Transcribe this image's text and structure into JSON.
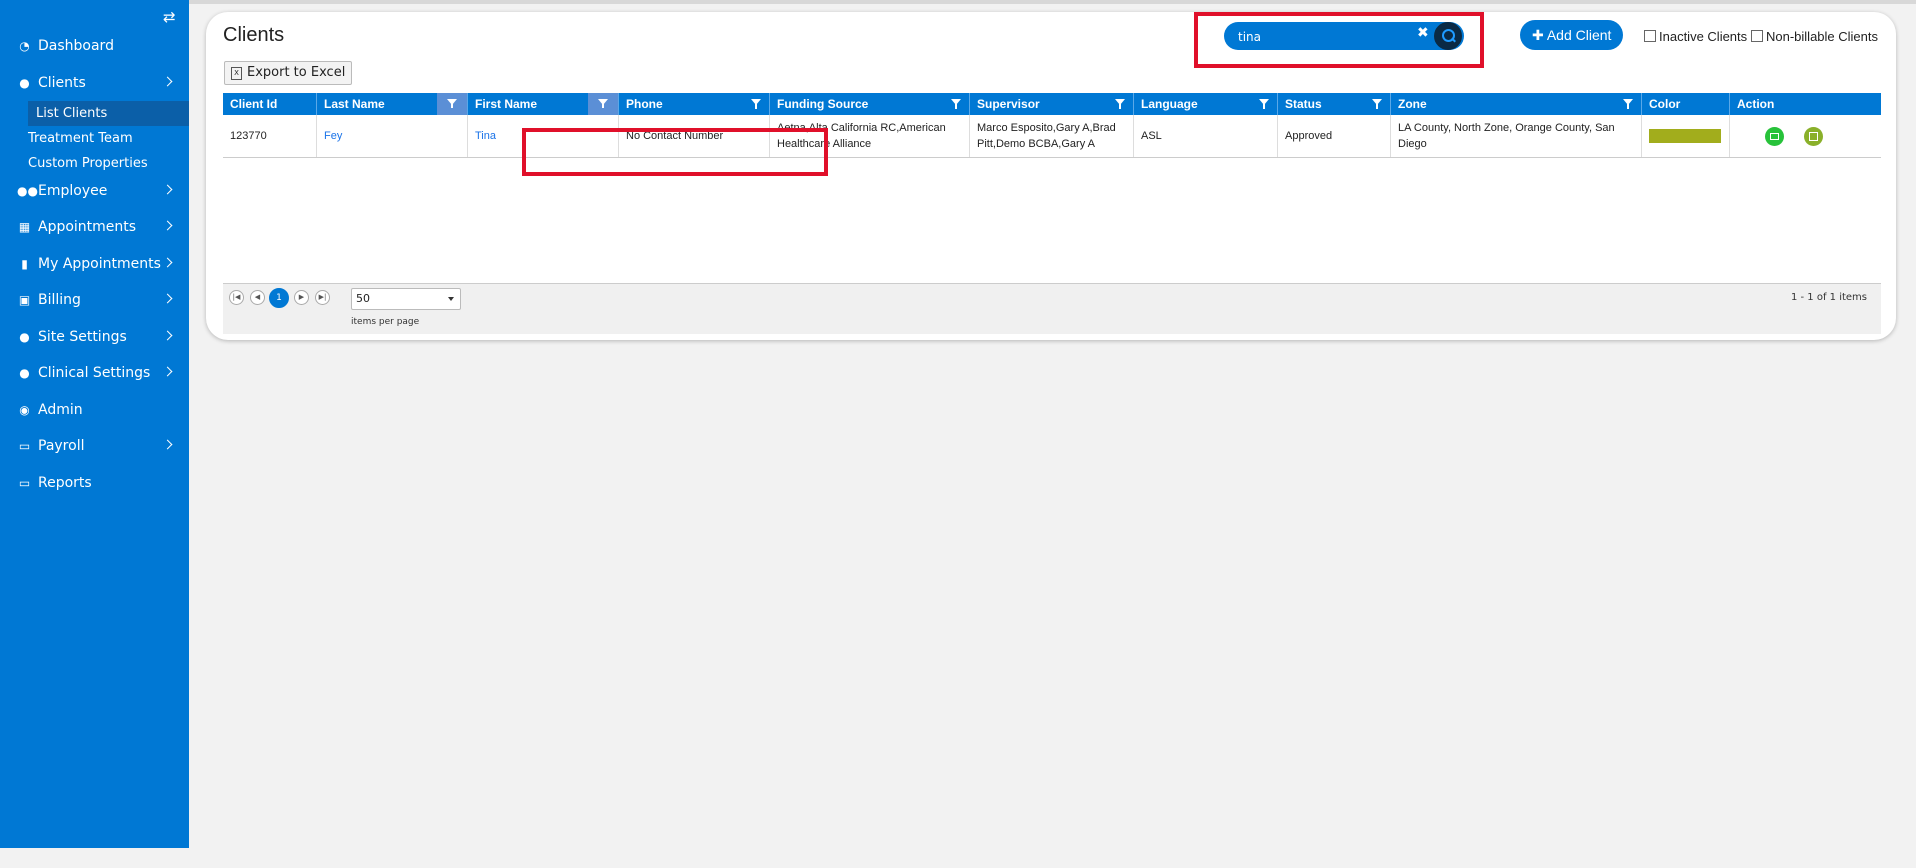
{
  "sidebar": {
    "toggle_icon": "swap-arrows-icon",
    "items": [
      {
        "label": "Dashboard",
        "icon": "dashboard-gauge-icon",
        "has_children": false
      },
      {
        "label": "Clients",
        "icon": "user-icon",
        "has_children": true
      },
      {
        "label": "Employee",
        "icon": "users-icon",
        "has_children": true
      },
      {
        "label": "Appointments",
        "icon": "calendar-icon",
        "has_children": true
      },
      {
        "label": "My Appointments",
        "icon": "bookmark-icon",
        "has_children": true
      },
      {
        "label": "Billing",
        "icon": "money-icon",
        "has_children": true
      },
      {
        "label": "Site Settings",
        "icon": "user-icon",
        "has_children": true
      },
      {
        "label": "Clinical Settings",
        "icon": "user-icon",
        "has_children": true
      },
      {
        "label": "Admin",
        "icon": "user-circle-icon",
        "has_children": false
      },
      {
        "label": "Payroll",
        "icon": "credit-card-icon",
        "has_children": true
      },
      {
        "label": "Reports",
        "icon": "credit-card-icon",
        "has_children": false
      }
    ],
    "clients_sub": [
      "List Clients",
      "Treatment Team",
      "Custom Properties"
    ]
  },
  "page": {
    "title": "Clients",
    "export_label": "Export to Excel",
    "search_value": "tina",
    "add_client_label": "✚ Add Client",
    "inactive_label": "Inactive Clients",
    "nonbillable_label": "Non-billable Clients"
  },
  "grid": {
    "columns": [
      "Client Id",
      "Last Name",
      "First Name",
      "Phone",
      "Funding Source",
      "Supervisor",
      "Language",
      "Status",
      "Zone",
      "Color",
      "Action"
    ],
    "rows": [
      {
        "client_id": "123770",
        "last_name": "Fey",
        "first_name": "Tina",
        "phone": "No Contact Number",
        "funding_source": "Aetna,Alta California RC,American Healthcare Alliance",
        "supervisor": "Marco Esposito,Gary A,Brad Pitt,Demo BCBA,Gary A",
        "language": "ASL",
        "status": "Approved",
        "zone": "LA County, North Zone, Orange County, San Diego",
        "color": "#a2ad1c"
      }
    ]
  },
  "pager": {
    "current_page": "1",
    "page_size": "50",
    "items_per_page_label": "items per page",
    "info": "1 - 1 of 1 items"
  },
  "colors": {
    "brand": "#0078d4",
    "highlight": "#e0102a"
  }
}
